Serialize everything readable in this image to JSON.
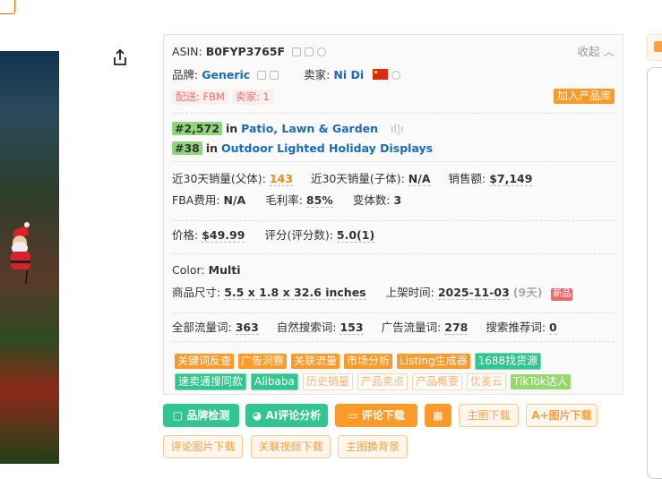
{
  "asin": {
    "label": "ASIN:",
    "value": "B0FYP3765F",
    "collapse": "收起"
  },
  "brand": {
    "label": "品牌:",
    "value": "Generic"
  },
  "seller": {
    "label": "卖家:",
    "value": "Ni Di"
  },
  "badges": {
    "delivery": "配送: FBM",
    "sellers": "卖家: 1",
    "add_to_library": "加入产品库"
  },
  "ranks": [
    {
      "rank": "#2,572",
      "in": "in",
      "category": "Patio, Lawn & Garden"
    },
    {
      "rank": "#38",
      "in": "in",
      "category": "Outdoor Lighted Holiday Displays"
    }
  ],
  "stats": {
    "parent_sales_label": "近30天销量(父体):",
    "parent_sales": "143",
    "child_sales_label": "近30天销量(子体):",
    "child_sales": "N/A",
    "revenue_label": "销售额:",
    "revenue": "$7,149",
    "fba_label": "FBA费用:",
    "fba": "N/A",
    "margin_label": "毛利率:",
    "margin": "85%",
    "variants_label": "变体数:",
    "variants": "3",
    "price_label": "价格:",
    "price": "$49.99",
    "rating_label": "评分(评分数):",
    "rating": "5.0(1)",
    "color_label": "Color:",
    "color": "Multi",
    "size_label": "商品尺寸:",
    "size": "5.5 x 1.8 x 32.6 inches",
    "listed_label": "上架时间:",
    "listed": "2025-11-03",
    "listed_days": "(9天)",
    "new_badge": "新品",
    "all_kw_label": "全部流量词:",
    "all_kw": "363",
    "organic_kw_label": "自然搜索词:",
    "organic_kw": "153",
    "ad_kw_label": "广告流量词:",
    "ad_kw": "278",
    "rec_kw_label": "搜索推荐词:",
    "rec_kw": "0"
  },
  "tools_row1": [
    "关键词反查",
    "广告洞察",
    "关联流量",
    "市场分析",
    "Listing生成器",
    "1688找货源"
  ],
  "tools_row2": [
    "速卖通搜同款",
    "Alibaba",
    "历史销量",
    "产品卖点",
    "产品概要",
    "优麦云",
    "TikTok达人"
  ],
  "buttons": {
    "brand_check": "品牌检测",
    "ai_review": "AI评论分析",
    "review_download": "评论下载",
    "main_image_download": "主图下载",
    "aplus_download": "A+图片下载",
    "review_image_download": "评论图片下载",
    "related_video_download": "关联视频下载",
    "replace_background": "主图换背景"
  }
}
